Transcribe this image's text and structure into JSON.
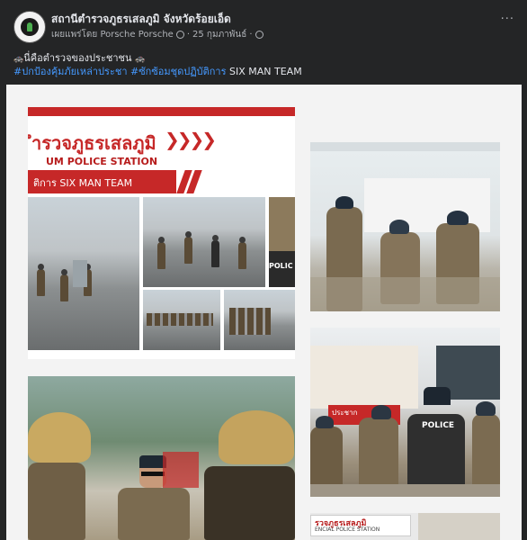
{
  "post": {
    "page_name": "สถานีตำรวจภูธรเสลภูมิ จังหวัดร้อยเอ็ด",
    "published_by": "เผยแพร่โดย Porsche Porsche",
    "date": "25 กุมภาพันธ์",
    "more_label": "···",
    "line1_text": "นี่คือตำรวจของประชาชน",
    "cop_emoji": "🚓",
    "hashtag1": "#ปกป้องคุ้มภัยเหล่าประชา",
    "hashtag2": "#ซักซ้อมชุดปฏิบัติการ",
    "hashtag2_suffix": "SIX MAN TEAM"
  },
  "gallery": {
    "photo1": {
      "title": "ำรวจภูธรเสลภูมิ",
      "chevrons": "❯❯❯❯",
      "subtitle": "UM  POLICE  STATION",
      "banner": "ติการ SIX MAN TEAM",
      "vest_label": "POLIC"
    },
    "photo2": {},
    "photo3": {},
    "photo4": {
      "sign": "ประชาก",
      "vest_label": "POLICE"
    },
    "photo5": {
      "sign": "รวจภูธรเสลภูมิ",
      "sign_sub": "ENCIAL POLICE STATION"
    }
  }
}
